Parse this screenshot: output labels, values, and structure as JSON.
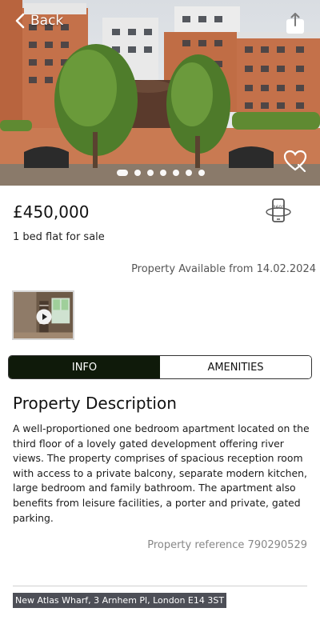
{
  "header": {
    "back_label": "Back"
  },
  "gallery": {
    "dot_count": 7,
    "active_index": 0
  },
  "listing": {
    "price": "£450,000",
    "type": "1 bed flat for sale",
    "availability": "Property Available from 14.02.2024"
  },
  "tabs": [
    {
      "label": "INFO",
      "active": true
    },
    {
      "label": "AMENITIES",
      "active": false
    }
  ],
  "description": {
    "title": "Property Description",
    "body": "A well-proportioned one bedroom apartment located on the third floor of a lovely gated development offering river views. The property comprises of spacious reception room with access to a private balcony, separate modern kitchen, large bedroom and family bathroom. The apartment also benefits from leisure facilities, a porter and private, gated parking.",
    "reference": "Property reference 790290529"
  },
  "address": "New Atlas Wharf, 3 Arnhem Pl, London E14 3ST",
  "colors": {
    "tab_active_bg": "#0f1a0a",
    "address_bg": "#4d4f57"
  }
}
